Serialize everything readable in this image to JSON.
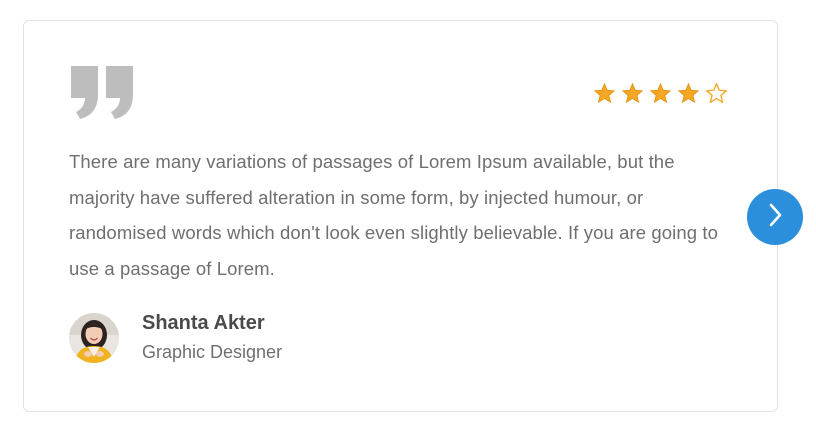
{
  "testimonial": {
    "text": "There are many variations of passages of Lorem Ipsum available, but the majority have suffered alteration in some form, by injected humour, or randomised words which don't look even slightly believable. If you are going to use a passage of Lorem.",
    "rating": {
      "value": 4,
      "max": 5,
      "filled_color": "#f5a623",
      "empty_color": "#f5a623"
    },
    "quote_icon": "quote-icon",
    "author": {
      "name": "Shanta Akter",
      "role": "Graphic Designer",
      "avatar_icon": "avatar"
    }
  },
  "navigation": {
    "next_icon": "chevron-right-icon",
    "accent_color": "#2b8fdb"
  }
}
